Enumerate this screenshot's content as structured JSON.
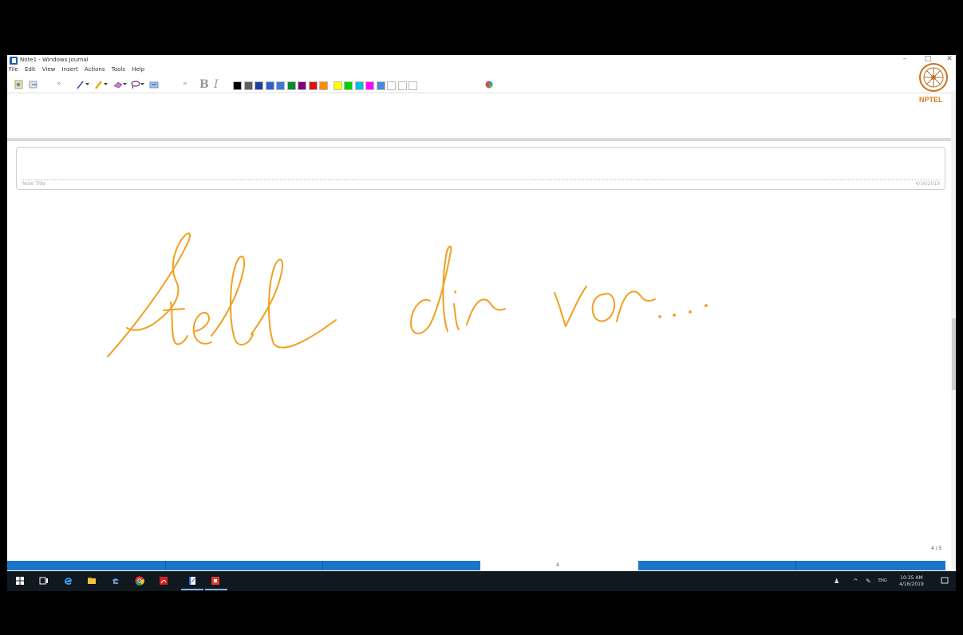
{
  "window": {
    "title": "Note1 - Windows Journal",
    "minimize": "–",
    "maximize": "□",
    "close": "✕"
  },
  "menu": [
    "File",
    "Edit",
    "View",
    "Insert",
    "Actions",
    "Tools",
    "Help"
  ],
  "toolbar": {
    "bold": "B",
    "italic": "I",
    "palette": [
      "#000000",
      "#606060",
      "#1f3fa0",
      "#2f5fd0",
      "#3a7bd5",
      "#0a8a2a",
      "#800080",
      "#e01010",
      "#ff8c00",
      "#ffff00",
      "#00d000",
      "#00c0e0",
      "#ff00ff",
      "#4a8ad8",
      "#ffffff",
      "#ffffff",
      "#ffffff"
    ]
  },
  "logo": {
    "text": "NPTEL"
  },
  "note": {
    "title_placeholder": "Note Title",
    "date": "4/16/2019",
    "ink_color": "#f0a020",
    "ink_text": "Stell dir vor..."
  },
  "status": {
    "page_counter": "4 / 5",
    "page_number": "4"
  },
  "taskbar": {
    "icons": [
      "start-icon",
      "task-view-icon",
      "edge-icon",
      "file-explorer-icon",
      "media-icon",
      "chrome-icon",
      "acrobat-icon",
      "journal-icon",
      "app-red-icon"
    ],
    "language": "ENG",
    "time": "10:35 AM",
    "date": "4/16/2019"
  }
}
